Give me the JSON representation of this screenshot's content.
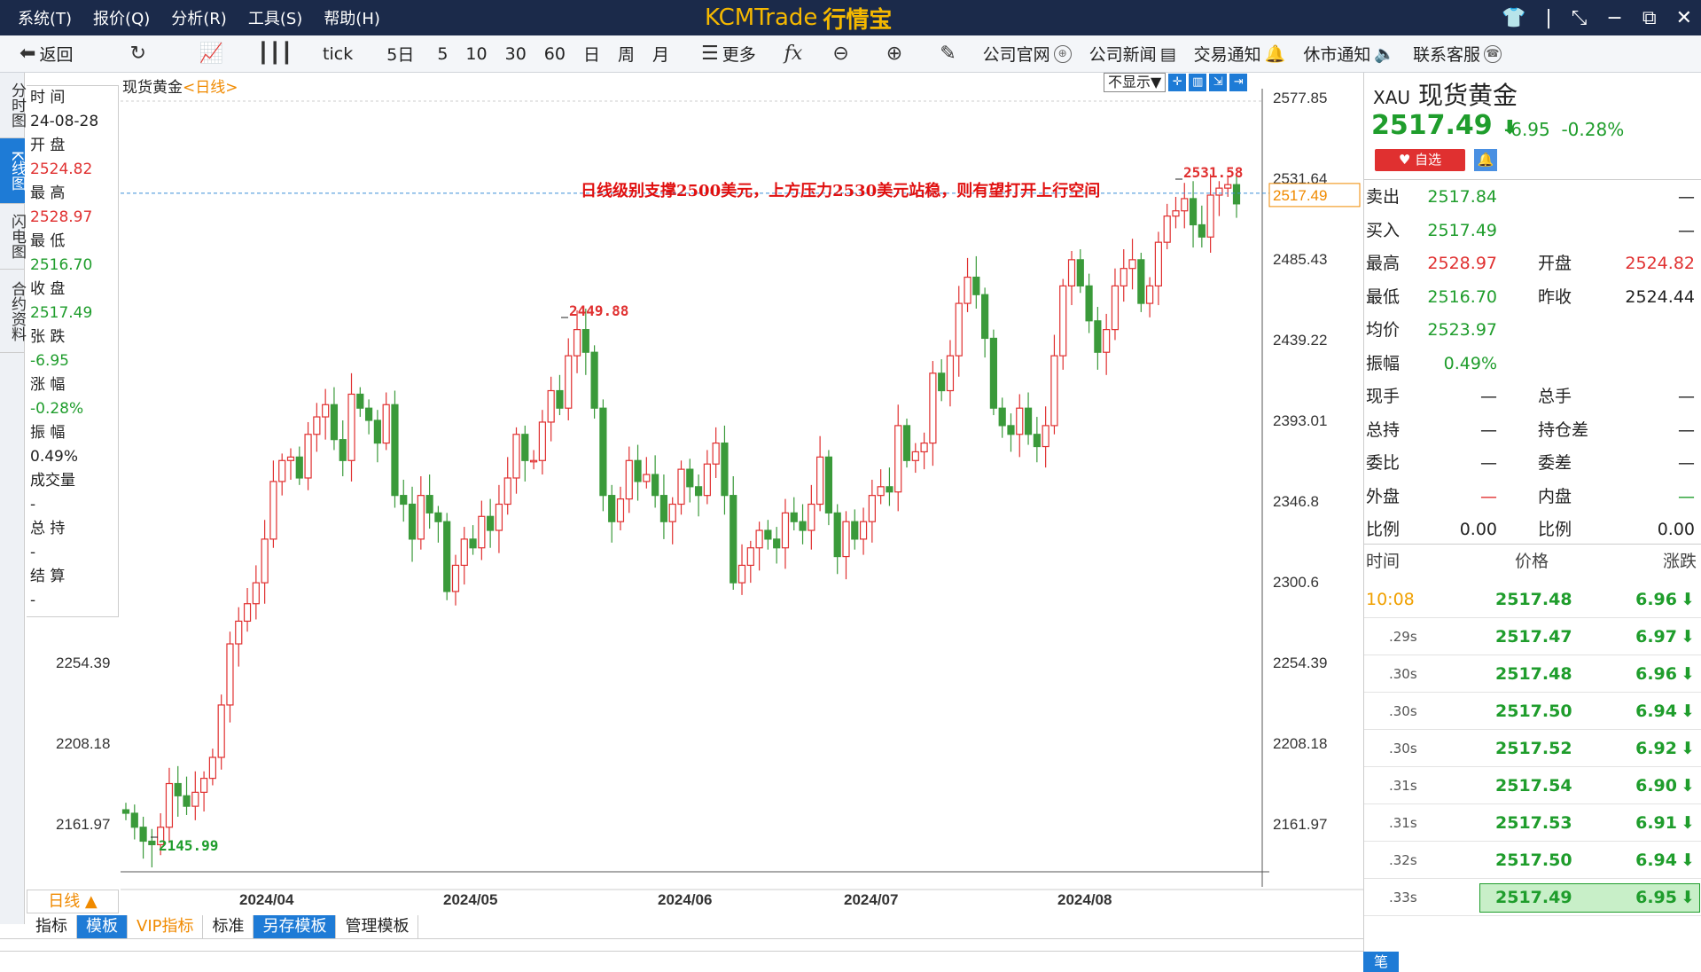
{
  "menu": [
    "系统(T)",
    "报价(Q)",
    "分析(R)",
    "工具(S)",
    "帮助(H)"
  ],
  "app_title": "KCMTrade",
  "app_title_cn": "行情宝",
  "toolbar": {
    "back": "返回",
    "tick": "tick",
    "periods": [
      "5日",
      "5",
      "10",
      "30",
      "60",
      "日",
      "周",
      "月"
    ],
    "more": "更多",
    "links": [
      "公司官网",
      "公司新闻",
      "交易通知",
      "休市通知",
      "联系客服"
    ]
  },
  "vtabs": [
    "分时图",
    "K线图",
    "闪电图",
    "合约资料"
  ],
  "info": [
    {
      "label": "时 间",
      "value": "24-08-28",
      "color": "black"
    },
    {
      "label": "开 盘",
      "value": "2524.82",
      "color": "red"
    },
    {
      "label": "最 高",
      "value": "2528.97",
      "color": "red"
    },
    {
      "label": "最 低",
      "value": "2516.70",
      "color": "green"
    },
    {
      "label": "收 盘",
      "value": "2517.49",
      "color": "green"
    },
    {
      "label": "张 跌",
      "value": "-6.95",
      "color": "green"
    },
    {
      "label": "涨 幅",
      "value": "-0.28%",
      "color": "green"
    },
    {
      "label": "振 幅",
      "value": "0.49%",
      "color": "black"
    },
    {
      "label": "成交量",
      "value": "-",
      "color": "black"
    },
    {
      "label": "总 持",
      "value": "-",
      "color": "black"
    },
    {
      "label": "结 算",
      "value": "-",
      "color": "black"
    }
  ],
  "chart_head": {
    "name": "现货黄金",
    "period": "<日线>"
  },
  "chart_ctl": {
    "hide": "不显示▼"
  },
  "chart_data": {
    "type": "candlestick",
    "annotation": "日线级别支撑2500美元，上方压力2530美元站稳，则有望打开上行空间",
    "y_ticks": [
      2577.85,
      2531.64,
      2485.43,
      2439.22,
      2393.01,
      2346.8,
      2300.6,
      2254.39,
      2208.18,
      2161.97
    ],
    "x_labels": [
      "2024/04",
      "2024/05",
      "2024/06",
      "2024/07",
      "2024/08"
    ],
    "ylim": [
      2136,
      2586
    ],
    "high_label": "2531.58",
    "low_label": "2145.99",
    "mid_label": "2449.88",
    "current_price": "2517.49",
    "closes": [
      2168,
      2160,
      2152,
      2150,
      2160,
      2185,
      2178,
      2172,
      2180,
      2188,
      2200,
      2230,
      2265,
      2278,
      2288,
      2300,
      2325,
      2358,
      2370,
      2372,
      2360,
      2385,
      2395,
      2402,
      2382,
      2370,
      2408,
      2400,
      2393,
      2380,
      2402,
      2350,
      2345,
      2325,
      2350,
      2340,
      2335,
      2295,
      2310,
      2325,
      2320,
      2338,
      2330,
      2345,
      2360,
      2385,
      2370,
      2370,
      2392,
      2410,
      2400,
      2430,
      2445,
      2432,
      2400,
      2350,
      2335,
      2348,
      2370,
      2358,
      2362,
      2350,
      2335,
      2345,
      2365,
      2355,
      2350,
      2368,
      2380,
      2350,
      2300,
      2310,
      2320,
      2330,
      2325,
      2320,
      2340,
      2335,
      2330,
      2345,
      2372,
      2340,
      2315,
      2335,
      2325,
      2335,
      2350,
      2355,
      2352,
      2390,
      2370,
      2375,
      2380,
      2420,
      2410,
      2430,
      2460,
      2475,
      2465,
      2440,
      2400,
      2390,
      2385,
      2400,
      2385,
      2378,
      2390,
      2430,
      2470,
      2485,
      2470,
      2450,
      2432,
      2445,
      2470,
      2480,
      2485,
      2460,
      2470,
      2495,
      2510,
      2513,
      2520,
      2505,
      2498,
      2522,
      2526,
      2528,
      2517
    ]
  },
  "bottom": {
    "period": "日线 ▲",
    "tabs": [
      "指标",
      "模板",
      "VIP指标",
      "标准",
      "另存模板",
      "管理模板"
    ]
  },
  "right": {
    "symbol": "XAU",
    "name": "现货黄金",
    "price": "2517.49",
    "change": "-6.95",
    "pct": "-0.28%",
    "fav": "♥ 自选",
    "quotes": [
      {
        "l1": "卖出",
        "v1": "2517.84",
        "v1c": "green",
        "l2": "",
        "v2": "—",
        "v2c": "black"
      },
      {
        "l1": "买入",
        "v1": "2517.49",
        "v1c": "green",
        "l2": "",
        "v2": "—",
        "v2c": "black"
      },
      {
        "l1": "最高",
        "v1": "2528.97",
        "v1c": "red",
        "l2": "开盘",
        "v2": "2524.82",
        "v2c": "red"
      },
      {
        "l1": "最低",
        "v1": "2516.70",
        "v1c": "green",
        "l2": "昨收",
        "v2": "2524.44",
        "v2c": "black"
      },
      {
        "l1": "均价",
        "v1": "2523.97",
        "v1c": "green",
        "l2": "",
        "v2": "",
        "v2c": "black"
      },
      {
        "l1": "振幅",
        "v1": "0.49%",
        "v1c": "green",
        "l2": "",
        "v2": "",
        "v2c": "black"
      },
      {
        "l1": "现手",
        "v1": "—",
        "v1c": "black",
        "l2": "总手",
        "v2": "—",
        "v2c": "black"
      },
      {
        "l1": "总持",
        "v1": "—",
        "v1c": "black",
        "l2": "持仓差",
        "v2": "—",
        "v2c": "black"
      },
      {
        "l1": "委比",
        "v1": "—",
        "v1c": "black",
        "l2": "委差",
        "v2": "—",
        "v2c": "black"
      },
      {
        "l1": "外盘",
        "v1": "—",
        "v1c": "red",
        "l2": "内盘",
        "v2": "—",
        "v2c": "green"
      },
      {
        "l1": "比例",
        "v1": "0.00",
        "v1c": "black",
        "l2": "比例",
        "v2": "0.00",
        "v2c": "black"
      }
    ],
    "tick_head": {
      "time": "时间",
      "price": "价格",
      "chg": "涨跌"
    },
    "ticks": [
      {
        "t": "10:08",
        "p": "2517.48",
        "c": "6.96"
      },
      {
        "t": ".29s",
        "p": "2517.47",
        "c": "6.97"
      },
      {
        "t": ".30s",
        "p": "2517.48",
        "c": "6.96"
      },
      {
        "t": ".30s",
        "p": "2517.50",
        "c": "6.94"
      },
      {
        "t": ".30s",
        "p": "2517.52",
        "c": "6.92"
      },
      {
        "t": ".31s",
        "p": "2517.54",
        "c": "6.90"
      },
      {
        "t": ".31s",
        "p": "2517.53",
        "c": "6.91"
      },
      {
        "t": ".32s",
        "p": "2517.50",
        "c": "6.94"
      },
      {
        "t": ".33s",
        "p": "2517.49",
        "c": "6.95"
      }
    ],
    "bottom_label": "笔"
  }
}
